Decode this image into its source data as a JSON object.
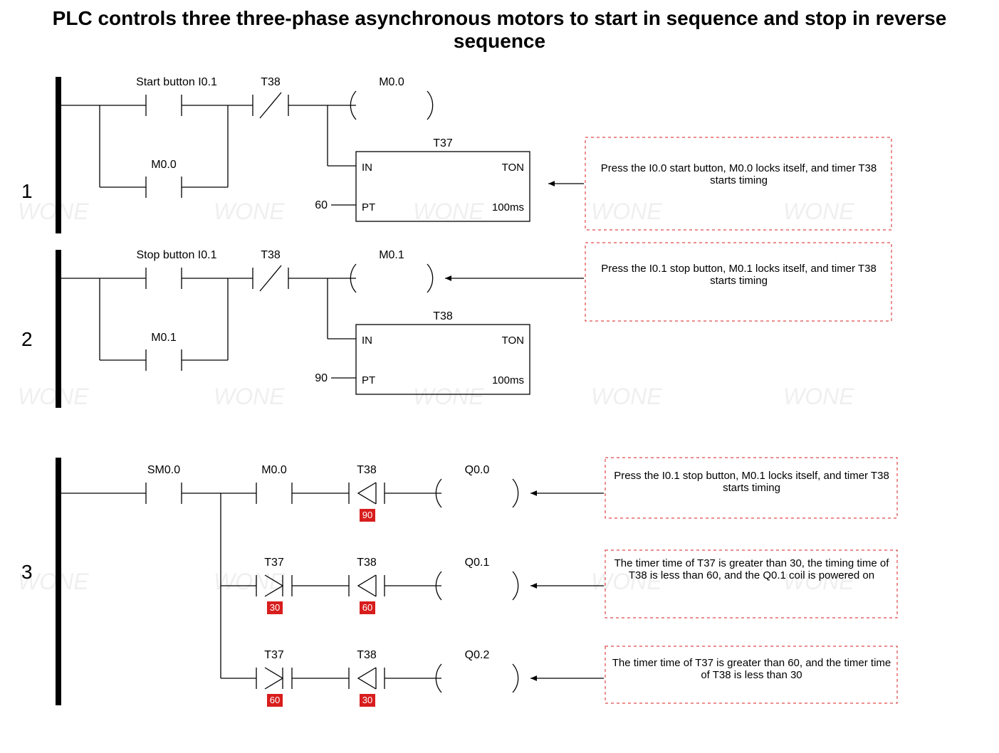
{
  "title": "PLC controls three three-phase asynchronous motors to start in sequence and stop in reverse sequence",
  "rungs": {
    "r1": {
      "num": "1",
      "contact1_label": "Start button I0.1",
      "contact1b_label": "M0.0",
      "nc_label": "T38",
      "coil_label": "M0.0",
      "timer_name": "T37",
      "timer_type": "TON",
      "timer_in": "IN",
      "timer_pt": "PT",
      "timer_res": "100ms",
      "pt_val": "60",
      "note": "Press the I0.0 start button, M0.0 locks itself, and timer T38 starts timing"
    },
    "r2": {
      "num": "2",
      "contact1_label": "Stop button I0.1",
      "contact1b_label": "M0.1",
      "nc_label": "T38",
      "coil_label": "M0.1",
      "timer_name": "T38",
      "timer_type": "TON",
      "timer_in": "IN",
      "timer_pt": "PT",
      "timer_res": "100ms",
      "pt_val": "90",
      "note": "Press the I0.1 stop button, M0.1 locks itself, and timer T38 starts timing"
    },
    "r3": {
      "num": "3",
      "sm_label": "SM0.0",
      "m_label": "M0.0",
      "row0": {
        "t38": "T38",
        "v_t38": "90",
        "coil": "Q0.0",
        "note": "Press the I0.1 stop button, M0.1 locks itself, and timer T38 starts timing"
      },
      "row1": {
        "t37": "T37",
        "v_t37": "30",
        "t38": "T38",
        "v_t38": "60",
        "coil": "Q0.1",
        "note": "The timer time of T37 is greater than 30, the timing time of T38 is less than 60, and the Q0.1 coil is powered on"
      },
      "row2": {
        "t37": "T37",
        "v_t37": "60",
        "t38": "T38",
        "v_t38": "30",
        "coil": "Q0.2",
        "note": "The timer time of T37 is greater than 60, and the timer time of T38 is less than 30"
      }
    }
  },
  "watermark": "WONE"
}
